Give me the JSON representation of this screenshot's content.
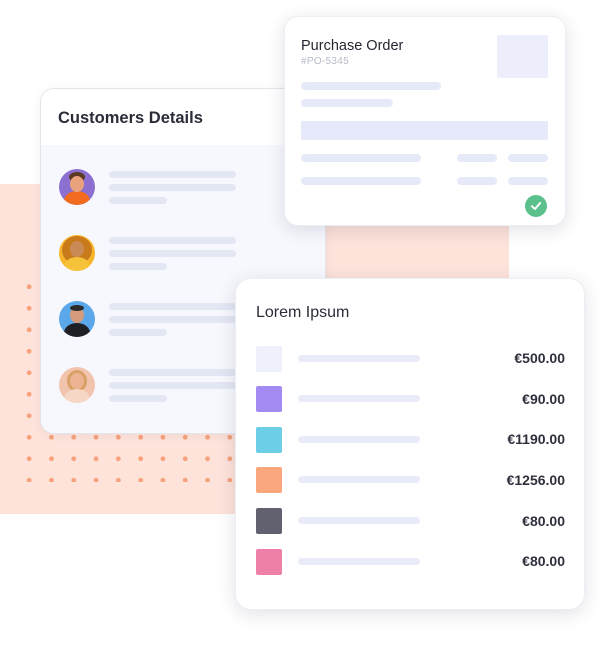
{
  "customers": {
    "title": "Customers Details",
    "avatars": [
      {
        "icon": "avatar-man-orange-shirt-icon",
        "bg": "#8b6fd1",
        "skin": "#e9a27c",
        "hair": "#5a3a22",
        "shirt": "#f26b1f"
      },
      {
        "icon": "avatar-woman-curly-hair-icon",
        "bg": "#f7b52a",
        "skin": "#c98a55",
        "hair": "#c97a1a",
        "shirt": "#f5c23a"
      },
      {
        "icon": "avatar-man-dark-jacket-icon",
        "bg": "#5aa8ea",
        "skin": "#d59b7c",
        "hair": "#2b2b2b",
        "shirt": "#1f2025"
      },
      {
        "icon": "avatar-woman-phone-icon",
        "bg": "#f2c3ad",
        "skin": "#ecb493",
        "hair": "#d9a066",
        "shirt": "#f6d7c6"
      }
    ]
  },
  "purchase_order": {
    "title": "Purchase Order",
    "number": "#PO-5345",
    "status_icon": "check-circle-icon",
    "status_color": "#5cc08c"
  },
  "lorem": {
    "title": "Lorem Ipsum",
    "rows": [
      {
        "color": "#eef0fc",
        "amount": "€500.00"
      },
      {
        "color": "#a38bf3",
        "amount": "€90.00"
      },
      {
        "color": "#6ccfe7",
        "amount": "€1190.00"
      },
      {
        "color": "#fba77e",
        "amount": "€1256.00"
      },
      {
        "color": "#62616f",
        "amount": "€80.00"
      },
      {
        "color": "#ee7fa9",
        "amount": "€80.00"
      }
    ]
  },
  "colors": {
    "peach_background": "#fde3da",
    "dots": "#f7a27c",
    "placeholder_bar": "#e3e6f3"
  }
}
